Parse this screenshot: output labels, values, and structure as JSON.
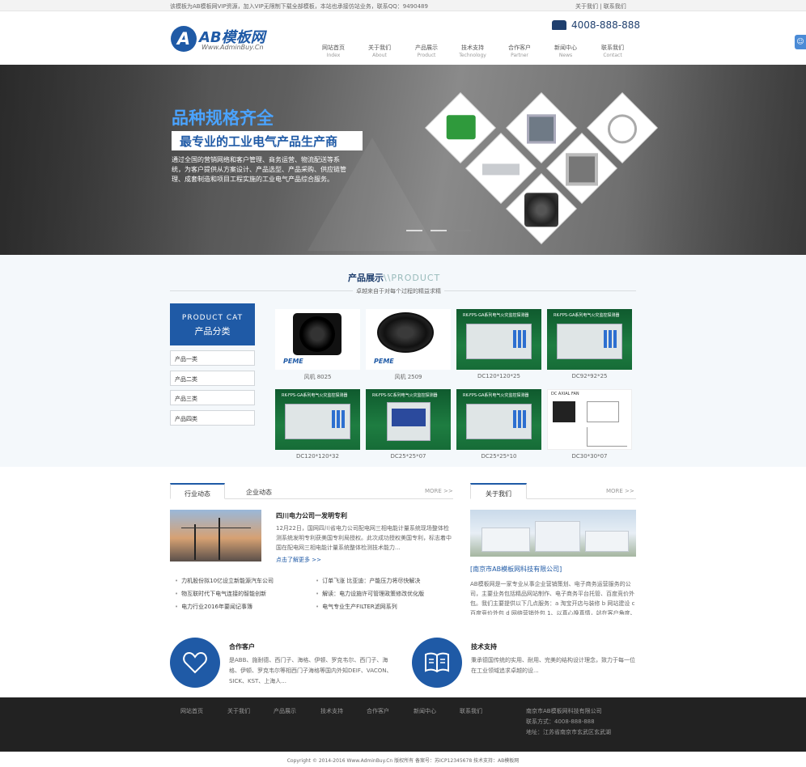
{
  "topbar": {
    "notice": "该模板为AB模板网VIP资源，加入VIP无限制下载全部模板，本站也承接仿站业务，联系QQ：9490489",
    "links": "关于我们 | 联系我们"
  },
  "header": {
    "logo_letter": "A",
    "logo_name": "AB模板网",
    "logo_url": "Www.AdminBuy.Cn",
    "phone": "4008-888-888",
    "nav": [
      {
        "cn": "网站首页",
        "en": "Index"
      },
      {
        "cn": "关于我们",
        "en": "About"
      },
      {
        "cn": "产品展示",
        "en": "Product"
      },
      {
        "cn": "技术支持",
        "en": "Technology"
      },
      {
        "cn": "合作客户",
        "en": "Partner"
      },
      {
        "cn": "新闻中心",
        "en": "News"
      },
      {
        "cn": "联系我们",
        "en": "Contact"
      }
    ]
  },
  "banner": {
    "headline": "品种规格齐全",
    "subheadline": "最专业的工业电气产品生产商",
    "text": "通过全国的营销网络和客户管理、商务运营、物流配送等系统，为客户提供从方案设计、产品选型、产品采购、供应链管理、成套制造和项目工程实施的工业电气产品综合服务。"
  },
  "products": {
    "title_cn": "产品展示",
    "title_en": "\\\\PRODUCT",
    "subtitle": "卓越来自于对每个过程的精益求精",
    "cat_en": "PRODUCT CAT",
    "cat_cn": "产品分类",
    "categories": [
      "产品一类",
      "产品二类",
      "产品三类",
      "产品四类"
    ],
    "items": [
      {
        "name": "风机 8025",
        "kind": "fan",
        "tag": "PEME"
      },
      {
        "name": "风机 2509",
        "kind": "fan2",
        "tag": "PEME"
      },
      {
        "name": "DC120*120*25",
        "kind": "meter",
        "tag": "RK-FPS-GA系列电气火灾监控探测器"
      },
      {
        "name": "DC92*92*25",
        "kind": "meter",
        "tag": "RK-FPS-GA系列电气火灾监控探测器"
      },
      {
        "name": "DC120*120*32",
        "kind": "meter",
        "tag": "RK-FPS-GA系列电气火灾监控探测器"
      },
      {
        "name": "DC25*25*07",
        "kind": "meter2",
        "tag": "RK-FPS-SC系列电气火灾监控探测器"
      },
      {
        "name": "DC25*25*10",
        "kind": "meter",
        "tag": "RK-FPS-GA系列电气火灾监控探测器"
      },
      {
        "name": "DC30*30*07",
        "kind": "spec",
        "tag": "DC AXIAL FAN"
      }
    ]
  },
  "news": {
    "tab1": "行业动态",
    "tab2": "企业动态",
    "more": "MORE >>",
    "headline": "四川电力公司一发明专利",
    "summary": "12月22日，国网四川省电力公司配电网三相电能计量系统现场整体检测系统发明专利获美国专利局授权。此次成功授权美国专利，标志着中国在配电网三相电能计量系统整体检测技术能力...",
    "read_more": "点击了解更多 >>",
    "list_left": [
      "力机股份拟10亿设立新能源汽车公司",
      "物互联时代下电气连接的智能创新",
      "电力行业2016年要闻记事簿"
    ],
    "list_right": [
      "订单飞涨 比亚迪：产能压力将尽快解决",
      "解读：电力设施许可管理政策修改优化版",
      "电气专业生产FILTER滤网系列"
    ]
  },
  "about": {
    "tab": "关于我们",
    "more": "MORE >>",
    "company": "[南京市AB模板网科技有限公司]",
    "text": "AB模板网是一家专业从事企业营销策划、电子商务运营服务的公司，主要业务包括精品网站制作、电子商务平台托管、百度竞价外包。我们主要提供以下几点服务：a 淘宝开店与装修 b 网站建设 c 百度竞价外包 d 网络营销外包 1、以真心换真情，站在客户角度、客户的满意就是我们的追求，切实结合客户意..."
  },
  "services": [
    {
      "title": "合作客户",
      "text": "是ABB、施耐德、西门子、海格、伊顿、罗克韦尔、西门子、海格、伊顿、罗克韦尔等相西门子海格等国内外知DEIF、VACON、SICK、KST、上海人..."
    },
    {
      "title": "技术支持",
      "text": "秉承德国传统的实用、耐用、完美的结构设计理念，致力于每一位在工业领域追求卓越的设..."
    }
  ],
  "footer": {
    "nav": [
      "网站首页",
      "关于我们",
      "产品展示",
      "技术支持",
      "合作客户",
      "新闻中心",
      "联系我们"
    ],
    "company": "南京市AB模板网科技有限公司",
    "contact": "联系方式：4008-888-888",
    "address": "地址：江苏省南京市玄武区玄武湖",
    "copyright": "Copyright © 2014-2016 Www.AdminBuy.Cn 版权所有 备案号：苏ICP12345678 技术支持：AB模板网"
  },
  "colors": {
    "brand": "#1f5aa6",
    "footer": "#222222",
    "product_bg": "#f4f8fb"
  }
}
